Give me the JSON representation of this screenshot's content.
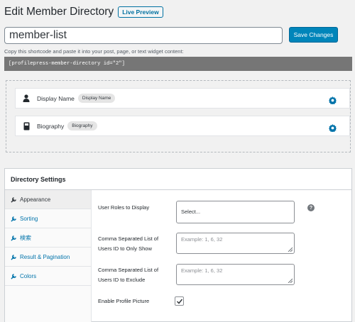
{
  "header": {
    "title": "Edit Member Directory",
    "preview_label": "Live Preview"
  },
  "directory_name": "member-list",
  "save_label": "Save Changes",
  "shortcode_hint": "Copy this shortcode and paste it into your post, page, or text widget content:",
  "shortcode": "[profilepress-member-directory id=\"2\"]",
  "fields": [
    {
      "label": "Display Name",
      "badge": "Display Name",
      "icon": "user-icon"
    },
    {
      "label": "Biography",
      "badge": "Biography",
      "icon": "book-icon"
    }
  ],
  "settings": {
    "title": "Directory Settings",
    "tabs": [
      {
        "label": "Appearance",
        "active": true
      },
      {
        "label": "Sorting"
      },
      {
        "label": "検索"
      },
      {
        "label": "Result & Pagination"
      },
      {
        "label": "Colors"
      }
    ],
    "user_roles_label": "User Roles to Display",
    "user_roles_value": "Select...",
    "include_label_1": "Comma Separated List of",
    "include_label_2": "Users ID to Only Show",
    "include_placeholder": "Example: 1, 6, 32",
    "exclude_label_1": "Comma Separated List of",
    "exclude_label_2": "Users ID to Exclude",
    "exclude_placeholder": "Example: 1, 6, 32",
    "profile_picture_label": "Enable Profile Picture",
    "profile_picture_checked": true,
    "help_glyph": "?"
  },
  "colors": {
    "accent": "#0085ba",
    "link": "#0073aa",
    "gear": "#0073aa"
  }
}
